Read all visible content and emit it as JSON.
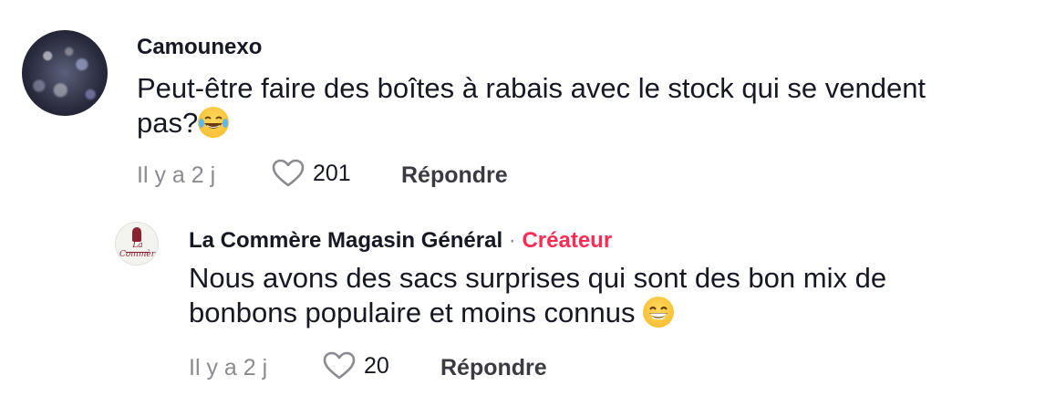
{
  "comments": [
    {
      "username": "Camounexo",
      "text_line1": "Peut-être faire des boîtes à rabais avec le stock qui se vendent",
      "text_line2": "pas?",
      "emoji": "face-with-tears-of-joy-icon",
      "time": "Il y a 2 j",
      "likes": "201",
      "reply_label": "Répondre"
    },
    {
      "username": "La Commère Magasin Général",
      "separator": "·",
      "badge": "Créateur",
      "avatar_logo_text": "La Commère",
      "text_line1": "Nous avons des sacs surprises qui sont des bon mix de",
      "text_line2": "bonbons populaire et moins connus",
      "emoji": "grinning-face-with-smiling-eyes-icon",
      "time": "Il y a 2 j",
      "likes": "20",
      "reply_label": "Répondre"
    }
  ],
  "colors": {
    "text": "#161823",
    "meta": "#8a8b91",
    "creator_badge": "#fe2c55"
  }
}
